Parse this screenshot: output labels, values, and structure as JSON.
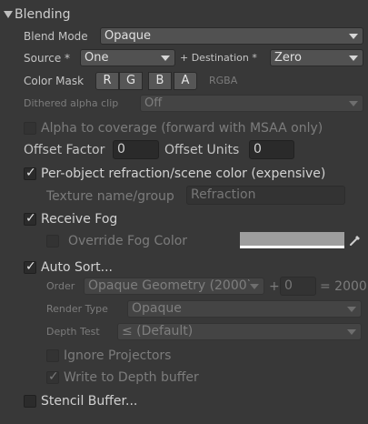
{
  "header": {
    "title": "Blending"
  },
  "blend_mode": {
    "label": "Blend Mode",
    "value": "Opaque"
  },
  "source": {
    "label": "Source *",
    "value": "One"
  },
  "destination": {
    "label": "+ Destination *",
    "value": "Zero"
  },
  "color_mask": {
    "label": "Color Mask",
    "buttons": [
      "R",
      "G",
      "B",
      "A"
    ],
    "value": "RGBA"
  },
  "dithered_alpha_clip": {
    "label": "Dithered alpha clip",
    "value": "Off"
  },
  "alpha_to_coverage": {
    "label": "Alpha to coverage (forward with MSAA only)",
    "checked": false
  },
  "offset_factor": {
    "label": "Offset Factor",
    "value": "0"
  },
  "offset_units": {
    "label": "Offset Units",
    "value": "0"
  },
  "refraction": {
    "label": "Per-object refraction/scene color (expensive)",
    "checked": true,
    "texture_label": "Texture name/group",
    "texture_value": "Refraction"
  },
  "receive_fog": {
    "label": "Receive Fog",
    "checked": true,
    "override_label": "Override Fog Color",
    "override_checked": false,
    "fog_color": "#9e9e9e"
  },
  "auto_sort": {
    "label": "Auto Sort...",
    "checked": true,
    "order_label": "Order",
    "order_value": "Opaque Geometry (2000)",
    "plus": "+",
    "order_offset": "0",
    "order_result": "= 2000",
    "render_type_label": "Render Type",
    "render_type_value": "Opaque",
    "depth_test_label": "Depth Test",
    "depth_test_value": "≤ (Default)",
    "ignore_projectors_label": "Ignore Projectors",
    "ignore_projectors_checked": false,
    "write_depth_label": "Write to Depth buffer",
    "write_depth_checked": true
  },
  "stencil": {
    "label": "Stencil Buffer...",
    "checked": false
  },
  "icons": {
    "foldout": "triangle-down-icon",
    "eyedropper": "eyedropper-icon",
    "check": "checkmark-icon"
  }
}
